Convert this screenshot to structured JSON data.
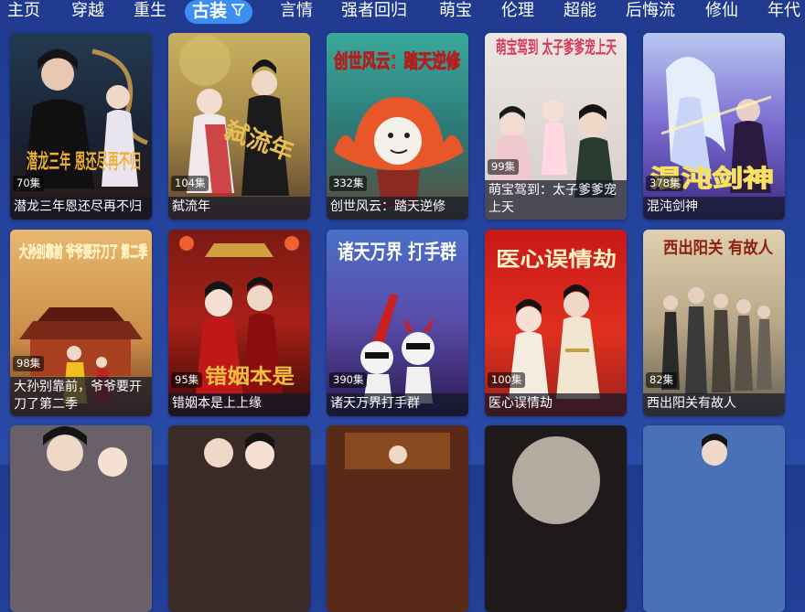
{
  "tabs": [
    {
      "label": "主页",
      "active": false
    },
    {
      "label": "穿越",
      "active": false
    },
    {
      "label": "重生",
      "active": false
    },
    {
      "label": "古装",
      "active": true
    },
    {
      "label": "言情",
      "active": false
    },
    {
      "label": "强者回归",
      "active": false
    },
    {
      "label": "萌宝",
      "active": false
    },
    {
      "label": "伦理",
      "active": false
    },
    {
      "label": "超能",
      "active": false
    },
    {
      "label": "后悔流",
      "active": false
    },
    {
      "label": "修仙",
      "active": false
    },
    {
      "label": "年代",
      "active": false
    }
  ],
  "active_tab_icon": "filter-icon",
  "colors": {
    "background": "#25449e",
    "active_tab": "#3c8ff0",
    "caption_overlay": "rgba(20,24,40,0.72)"
  },
  "dramas": [
    {
      "title": "潜龙三年恩还尽再不归",
      "episodes": "70集",
      "poster_text": "潜龙三年 恩还尽再不归"
    },
    {
      "title": "弑流年",
      "episodes": "104集",
      "poster_text": "弑流年"
    },
    {
      "title": "创世风云：踏天逆修",
      "episodes": "332集",
      "poster_text": "创世风云：踏天逆修"
    },
    {
      "title": "萌宝驾到：太子爹爹宠上天",
      "episodes": "99集",
      "poster_text": "萌宝驾到 太子爹爹宠上天"
    },
    {
      "title": "混沌剑神",
      "episodes": "378集",
      "poster_text": "混沌剑神"
    },
    {
      "title": "大孙别靠前，爷爷要开刀了第二季",
      "episodes": "98集",
      "poster_text": "大孙别靠前 爷爷要开刀了 第二季"
    },
    {
      "title": "错姻本是上上缘",
      "episodes": "95集",
      "poster_text": "错姻本是"
    },
    {
      "title": "诸天万界打手群",
      "episodes": "390集",
      "poster_text": "诸天万界 打手群"
    },
    {
      "title": "医心误情劫",
      "episodes": "100集",
      "poster_text": "医心误情劫"
    },
    {
      "title": "西出阳关有故人",
      "episodes": "82集",
      "poster_text": "西出阳关 有故人"
    }
  ],
  "partial_row": [
    {
      "poster": "couple"
    },
    {
      "poster": "palace-dark"
    },
    {
      "poster": "court"
    },
    {
      "poster": "moon"
    },
    {
      "poster": "sky"
    }
  ]
}
